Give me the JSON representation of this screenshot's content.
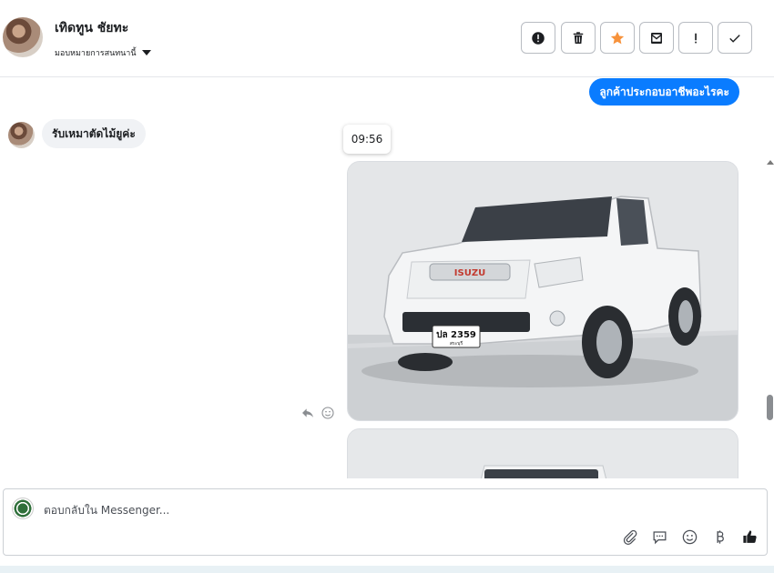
{
  "header": {
    "contact_name": "เทิดทูน ชัยทะ",
    "assign_label": "มอบหมายการสนทนานี้",
    "actions": [
      {
        "name": "report-spam",
        "icon": "alert-circle-icon"
      },
      {
        "name": "delete",
        "icon": "trash-icon"
      },
      {
        "name": "star",
        "icon": "star-icon"
      },
      {
        "name": "mark-unread",
        "icon": "envelope-icon"
      },
      {
        "name": "follow-up",
        "icon": "exclamation-icon"
      },
      {
        "name": "done",
        "icon": "check-icon"
      }
    ]
  },
  "messages": {
    "outgoing_text": "ลูกค้าประกอบอาชีพอะไรคะ",
    "incoming_text": "รับเหมาตัดไม้ยูค่ะ",
    "timestamp": "09:56",
    "photo_plate": "ปล 2359",
    "photo_plate_province": "สระบุรี",
    "photo_brand": "ISUZU"
  },
  "composer": {
    "placeholder": "ตอบกลับใน Messenger..."
  },
  "colors": {
    "accent": "#0a7cff",
    "incoming_bubble": "#f0f2f5",
    "star": "#f7923b"
  }
}
